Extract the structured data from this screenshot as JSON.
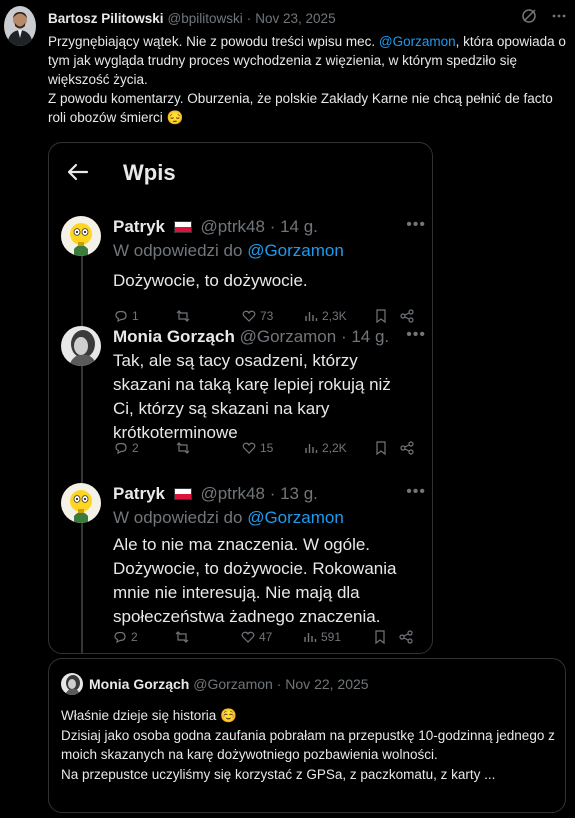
{
  "tweet": {
    "author_name": "Bartosz Pilitowski",
    "handle": "@bpilitowski",
    "separator": "·",
    "date": "Nov 23, 2025",
    "text_line1_a": "Przygnębiający wątek. Nie z powodu treści wpisu mec. ",
    "text_line1_mention": "@Gorzamon",
    "text_line1_b": ", która opowiada o tym jak wygląda trudny proces wychodzenia z więzienia, w którym spedziło się większość życia.",
    "text_line2": "Z powodu komentarzy. Oburzenia, że polskie Zakłady Karne nie chcą pełnić de facto roli obozów śmierci",
    "text_emoji": "😔",
    "more_icon": "more-horizontal-icon",
    "grok_icon": "grok-icon"
  },
  "screenshot": {
    "title": "Wpis",
    "replies": [
      {
        "name": "Patryk",
        "handle": "@ptrk48",
        "time": "· 14 g.",
        "in_reply_label": "W odpowiedzi do ",
        "in_reply_mention": "@Gorzamon",
        "text": "Dożywocie, to dożywocie.",
        "replies": "1",
        "retweets": "",
        "likes": "73",
        "views": "2,3K"
      },
      {
        "name": "Monia Gorząch",
        "handle": "@Gorzamon",
        "time": "· 14 g.",
        "text": "Tak, ale są tacy osadzeni, którzy skazani na taką karę lepiej rokują niż Ci, którzy są skazani na kary krótkoterminowe",
        "replies": "2",
        "retweets": "",
        "likes": "15",
        "views": "2,2K"
      },
      {
        "name": "Patryk",
        "handle": "@ptrk48",
        "time": "· 13 g.",
        "in_reply_label": "W odpowiedzi do ",
        "in_reply_mention": "@Gorzamon",
        "text": "Ale to nie ma znaczenia. W ogóle. Dożywocie, to dożywocie. Rokowania mnie nie interesują. Nie mają dla społeczeństwa żadnego znaczenia.",
        "replies": "2",
        "retweets": "",
        "likes": "47",
        "views": "591"
      }
    ]
  },
  "quote": {
    "author_name": "Monia Gorząch",
    "handle": "@Gorzamon",
    "separator": "·",
    "date": "Nov 22, 2025",
    "line1": "Właśnie dzieje się historia",
    "line1_emoji": "☺️",
    "line2": "Dzisiaj jako osoba godna zaufania pobrałam na przepustkę 10-godzinną jednego z moich skazanych na karę dożywotniego pozbawienia wolności.",
    "line3": "Na przepustce uczyliśmy się korzystać z GPSa, z paczkomatu, z karty ..."
  },
  "colors": {
    "background": "#000000",
    "text": "#e7e9ea",
    "muted": "#71767b",
    "link": "#1d9bf0",
    "border": "#2f3336"
  }
}
